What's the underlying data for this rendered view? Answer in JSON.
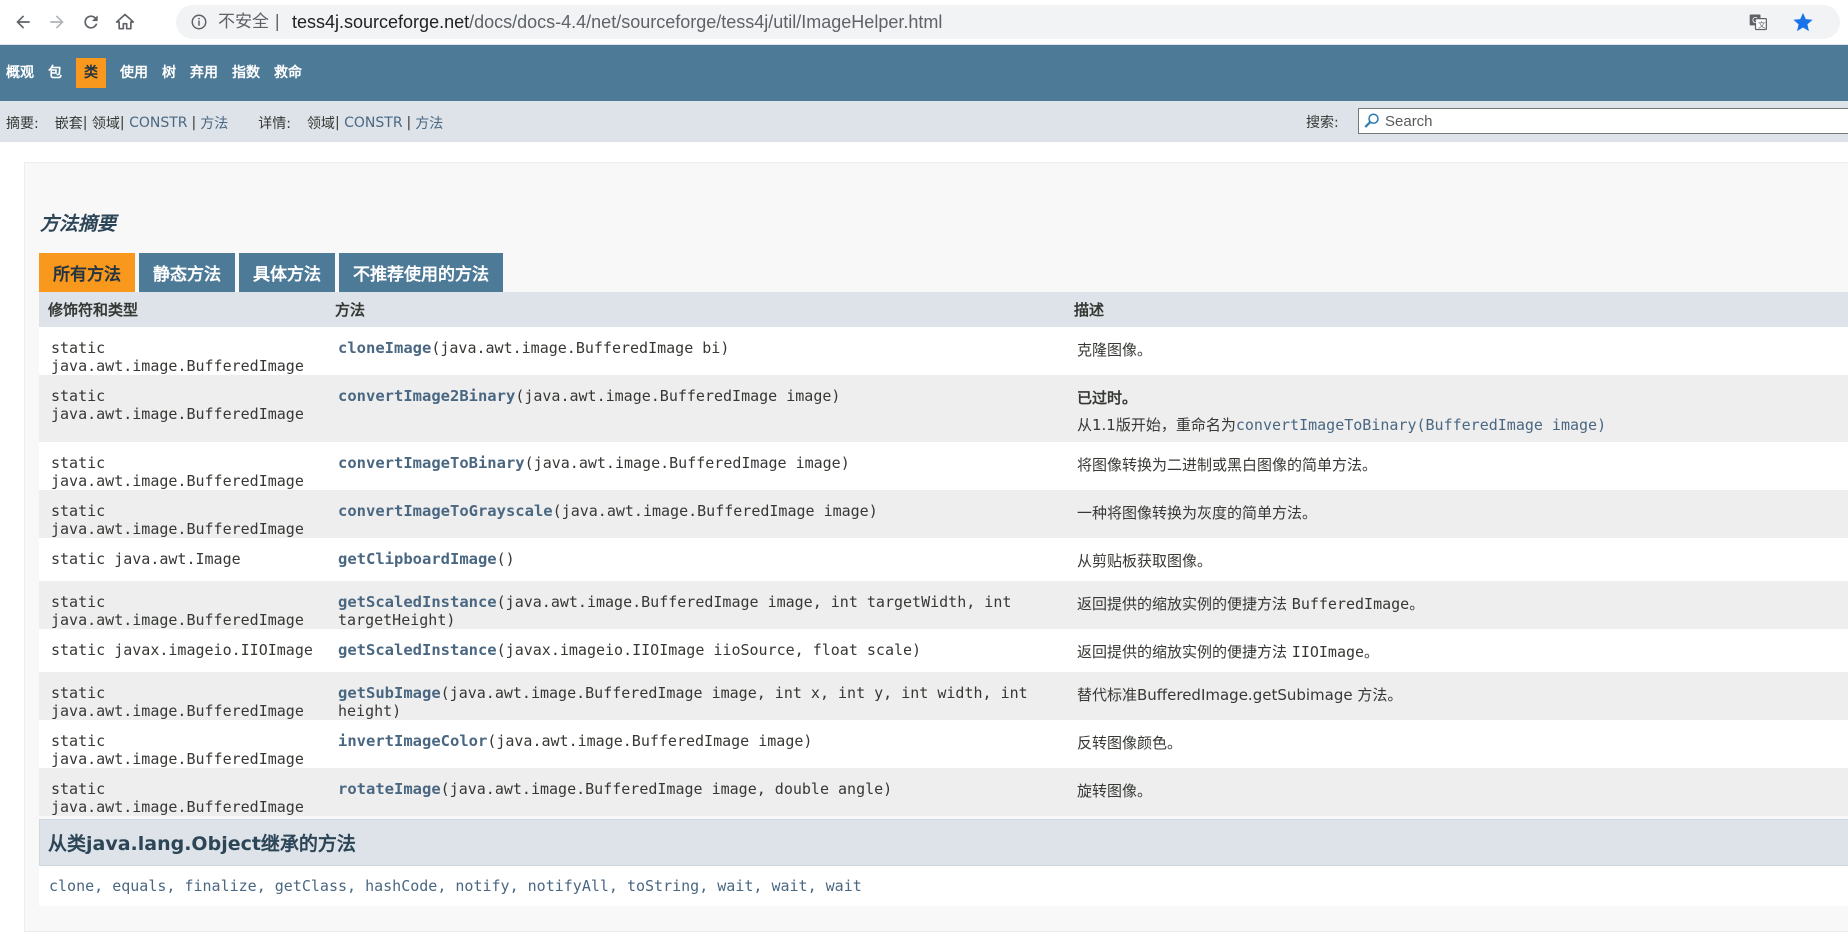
{
  "browser": {
    "security_label": "不安全",
    "url_host": "tess4j.sourceforge.net",
    "url_path": "/docs/docs-4.4/net/sourceforge/tess4j/util/ImageHelper.html"
  },
  "topnav": {
    "items": [
      "概观",
      "包",
      "类",
      "使用",
      "树",
      "弃用",
      "指数",
      "救命"
    ],
    "active_index": 2
  },
  "subnav": {
    "summary_label": "摘要:",
    "summary_nested": "嵌套",
    "summary_field": "领域",
    "summary_constr": "CONSTR",
    "summary_method": "方法",
    "detail_label": "详情:",
    "detail_field": "领域",
    "detail_constr": "CONSTR",
    "detail_method": "方法",
    "search_label": "搜索:",
    "search_placeholder": "Search"
  },
  "method_summary": {
    "title": "方法摘要",
    "tabs": [
      "所有方法",
      "静态方法",
      "具体方法",
      "不推荐使用的方法"
    ],
    "headers": [
      "修饰符和类型",
      "方法",
      "描述"
    ],
    "rows": [
      {
        "type": "static java.awt.image.BufferedImage",
        "name": "cloneImage",
        "params": "(java.awt.image.BufferedImage  bi)",
        "desc": "克隆图像。"
      },
      {
        "type": "static java.awt.image.BufferedImage",
        "name": "convertImage2Binary",
        "params": "(java.awt.image.BufferedImage  image)",
        "deprecated": "已过时。",
        "desc_prefix": "从1.1版开始，重命名为",
        "desc_code": "convertImageToBinary(BufferedImage image)"
      },
      {
        "type": "static java.awt.image.BufferedImage",
        "name": "convertImageToBinary",
        "params": "(java.awt.image.BufferedImage  image)",
        "desc": "将图像转换为二进制或黑白图像的简单方法。"
      },
      {
        "type": "static java.awt.image.BufferedImage",
        "name": "convertImageToGrayscale",
        "params": "(java.awt.image.BufferedImage  image)",
        "desc": "一种将图像转换为灰度的简单方法。"
      },
      {
        "type": "static java.awt.Image",
        "name": "getClipboardImage",
        "params": "()",
        "desc": "从剪贴板获取图像。"
      },
      {
        "type": "static java.awt.image.BufferedImage",
        "name": "getScaledInstance",
        "params": "(java.awt.image.BufferedImage  image, int  targetWidth, int  targetHeight)",
        "desc": "返回提供的缩放实例的便捷方法",
        "desc_code": "BufferedImage",
        "desc_suffix": "。"
      },
      {
        "type": "static javax.imageio.IIOImage",
        "name": "getScaledInstance",
        "params": "(javax.imageio.IIOImage  iioSource, float  scale)",
        "desc": "返回提供的缩放实例的便捷方法",
        "desc_code": "IIOImage",
        "desc_suffix": "。"
      },
      {
        "type": "static java.awt.image.BufferedImage",
        "name": "getSubImage",
        "params": "(java.awt.image.BufferedImage  image, int  x, int  y, int  width, int  height)",
        "desc": "替代标准BufferedImage.getSubimage 方法。"
      },
      {
        "type": "static java.awt.image.BufferedImage",
        "name": "invertImageColor",
        "params": "(java.awt.image.BufferedImage  image)",
        "desc": "反转图像颜色。"
      },
      {
        "type": "static java.awt.image.BufferedImage",
        "name": "rotateImage",
        "params": "(java.awt.image.BufferedImage  image, double  angle)",
        "desc": "旋转图像。"
      }
    ]
  },
  "inherited": {
    "title": "从类java.lang.Object继承的方法",
    "methods": "clone, equals, finalize, getClass, hashCode, notify, notifyAll, toString, wait, wait, wait"
  },
  "colors": {
    "nav_bg": "#4d7a97",
    "active_tab": "#f8981d",
    "link": "#4a6782",
    "header_bg": "#dee3e9"
  }
}
